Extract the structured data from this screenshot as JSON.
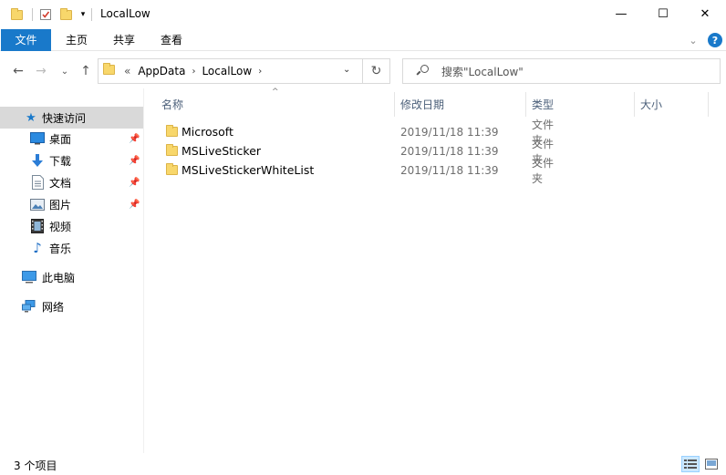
{
  "window": {
    "title": "LocalLow",
    "minimize": "—",
    "maximize": "☐",
    "close": "✕"
  },
  "ribbon": {
    "tabs": [
      "文件",
      "主页",
      "共享",
      "查看"
    ],
    "help": "?"
  },
  "nav": {
    "back": "←",
    "forward": "→",
    "recent": "⌄",
    "up": "↑",
    "overflow": "«",
    "breadcrumb": [
      "AppData",
      "LocalLow"
    ],
    "refresh": "↻",
    "search_placeholder": "搜索\"LocalLow\""
  },
  "sidebar": {
    "quick_access": "快速访问",
    "items": [
      {
        "label": "桌面",
        "icon": "desktop-icon",
        "pinned": true
      },
      {
        "label": "下载",
        "icon": "download-icon",
        "pinned": true
      },
      {
        "label": "文档",
        "icon": "documents-icon",
        "pinned": true
      },
      {
        "label": "图片",
        "icon": "pictures-icon",
        "pinned": true
      },
      {
        "label": "视频",
        "icon": "videos-icon",
        "pinned": false
      },
      {
        "label": "音乐",
        "icon": "music-icon",
        "pinned": false
      }
    ],
    "this_pc": "此电脑",
    "network": "网络"
  },
  "columns": {
    "name": "名称",
    "date": "修改日期",
    "type": "类型",
    "size": "大小"
  },
  "files": [
    {
      "name": "Microsoft",
      "date": "2019/11/18 11:39",
      "type": "文件夹"
    },
    {
      "name": "MSLiveSticker",
      "date": "2019/11/18 11:39",
      "type": "文件夹"
    },
    {
      "name": "MSLiveStickerWhiteList",
      "date": "2019/11/18 11:39",
      "type": "文件夹"
    }
  ],
  "status": {
    "item_count": "3 个项目"
  },
  "colors": {
    "accent": "#1979ca",
    "folder": "#f8d76b",
    "selection": "#d9d9d9"
  }
}
